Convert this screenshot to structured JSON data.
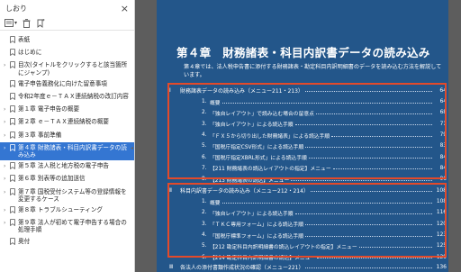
{
  "panel": {
    "title": "しおり",
    "close_glyph": "×",
    "tools": {
      "options_label": "▾"
    }
  },
  "bookmarks": [
    {
      "label": "表紙",
      "chevron": "",
      "selected": false
    },
    {
      "label": "はじめに",
      "chevron": "",
      "selected": false
    },
    {
      "label": "目次(タイトルをクリックすると該当箇所にジャンプ)",
      "chevron": "›",
      "selected": false
    },
    {
      "label": "電子申告義務化に向けた留意事項",
      "chevron": "",
      "selected": false
    },
    {
      "label": "令和2年度ｅ－ＴＡＸ連続納税の改訂内容",
      "chevron": "",
      "selected": false
    },
    {
      "label": "第１章  電子申告の概要",
      "chevron": "›",
      "selected": false
    },
    {
      "label": "第２章  ｅ－ＴＡＸ連続納税の概要",
      "chevron": "›",
      "selected": false
    },
    {
      "label": "第３章  事前準備",
      "chevron": "›",
      "selected": false
    },
    {
      "label": "第４章  財務諸表・科目内訳書データの読み込み",
      "chevron": "›",
      "selected": true
    },
    {
      "label": "第５章  法人税と地方税の電子申告",
      "chevron": "›",
      "selected": false
    },
    {
      "label": "第６章  別表等の追加送信",
      "chevron": "›",
      "selected": false
    },
    {
      "label": "第７章  国税受付システム等の登録情報を変更するケース",
      "chevron": "›",
      "selected": false
    },
    {
      "label": "第８章  トラブルシューティング",
      "chevron": "›",
      "selected": false
    },
    {
      "label": "第９章  法人が初めて電子申告する場合の処理手順",
      "chevron": "›",
      "selected": false
    },
    {
      "label": "奥付",
      "chevron": "",
      "selected": false
    }
  ],
  "scroll_arrow": "◂",
  "document": {
    "chapter_title": "第４章　財務諸表・科目内訳書データの読み込み",
    "intro": "第４章では、法人税申告書に添付する財務諸表・勘定科目内訳明細書のデータを読み込む方法を解説しています。",
    "section1": {
      "roman": "Ⅰ",
      "title": "財務諸表データの読み込み（メニュー211・213）",
      "page": "64",
      "items": [
        {
          "num": "1.",
          "title": "概要",
          "page": "64"
        },
        {
          "num": "2.",
          "title": "「独自レイアウト」で読み込む場合の留意点",
          "page": "68"
        },
        {
          "num": "3.",
          "title": "「独自レイアウト」による読込手順",
          "page": "71"
        },
        {
          "num": "4.",
          "title": "「ＦＸ５から切り出した財務諸表」による読込手順",
          "page": "79"
        },
        {
          "num": "5.",
          "title": "「国税庁指定CSV形式」による読込手順",
          "page": "83"
        },
        {
          "num": "6.",
          "title": "「国税庁指定XBRL形式」による読込手順",
          "page": "84"
        },
        {
          "num": "7.",
          "title": "【211 財務諸表の読込レイアウトの指定】メニュー",
          "page": "84"
        },
        {
          "num": "8.",
          "title": "【213 財務諸表の読込】メニュー",
          "page": "96"
        }
      ]
    },
    "section2": {
      "roman": "Ⅱ",
      "title": "科目内訳書データの読み込み（メニュー212・214）",
      "page": "108",
      "items": [
        {
          "num": "1.",
          "title": "概要",
          "page": "108"
        },
        {
          "num": "2.",
          "title": "「独自レイアウト」による読込手順",
          "page": "116"
        },
        {
          "num": "3.",
          "title": "「ＴＫＣ専用フォーム」による読込手順",
          "page": "120"
        },
        {
          "num": "4.",
          "title": "「国税庁標準フォーム」による読込手順",
          "page": "123"
        },
        {
          "num": "5.",
          "title": "【212 勘定科目内訳明細書の読込レイアウトの指定】メニュー",
          "page": "125"
        },
        {
          "num": "6.",
          "title": "【214 勘定科目内訳明細書の読込】メニュー",
          "page": "129"
        }
      ]
    },
    "section3": {
      "roman": "Ⅲ",
      "title": "各法人の添付書類作成状況の確認（メニュー221）",
      "page": "136"
    }
  },
  "colors": {
    "page_bg": "#23568a",
    "highlight": "#e34a2a",
    "selected_bookmark": "#3476d2"
  }
}
